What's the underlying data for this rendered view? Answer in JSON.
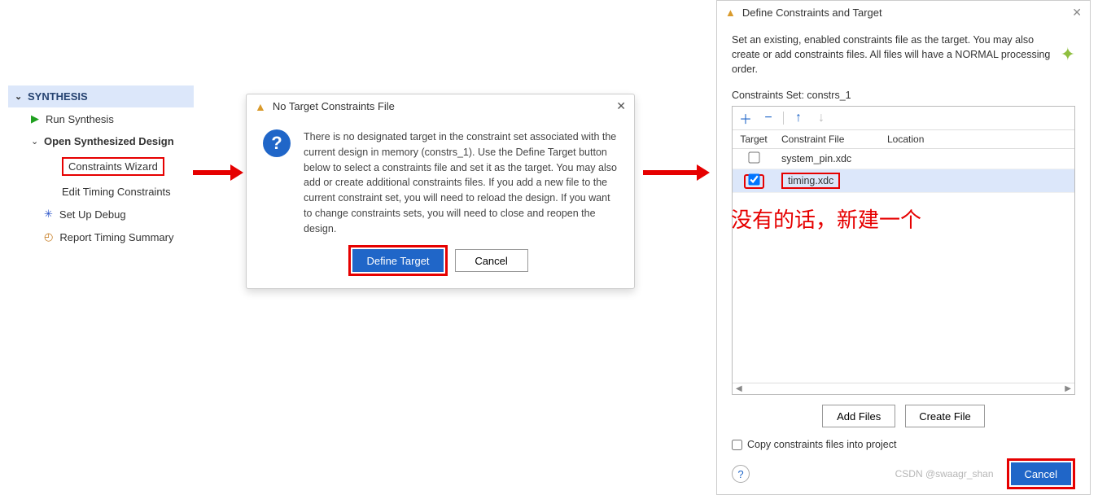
{
  "nav": {
    "section": "SYNTHESIS",
    "run": "Run Synthesis",
    "open": "Open Synthesized Design",
    "wizard": "Constraints Wizard",
    "edit_timing": "Edit Timing Constraints",
    "set_up_debug": "Set Up Debug",
    "report_timing": "Report Timing Summary"
  },
  "dlg1": {
    "title": "No Target Constraints File",
    "message": "There is no designated target in the constraint set associated with the current design in memory (constrs_1). Use the Define Target button below to select a constraints file and set it as the target. You may also add or create additional constraints files. If you add a new file to the current constraint set, you will need to reload the design. If you want to change constraints sets, you will need to close and reopen the design.",
    "define": "Define Target",
    "cancel": "Cancel"
  },
  "dlg2": {
    "title": "Define Constraints and Target",
    "desc": "Set an existing, enabled constraints file as the target. You may also create or add constraints files. All files will have a NORMAL processing order.",
    "cs_label": "Constraints Set: constrs_1",
    "headers": {
      "target": "Target",
      "file": "Constraint File",
      "loc": "Location"
    },
    "rows": [
      {
        "checked": false,
        "file": "system_pin.xdc",
        "loc": ""
      },
      {
        "checked": true,
        "file": "timing.xdc",
        "loc": ""
      }
    ],
    "add_files": "Add Files",
    "create_file": "Create File",
    "copy_label": "Copy constraints files into project",
    "cancel": "Cancel"
  },
  "annotation": "没有的话，新建一个",
  "watermark": "CSDN @swaagr_shan"
}
